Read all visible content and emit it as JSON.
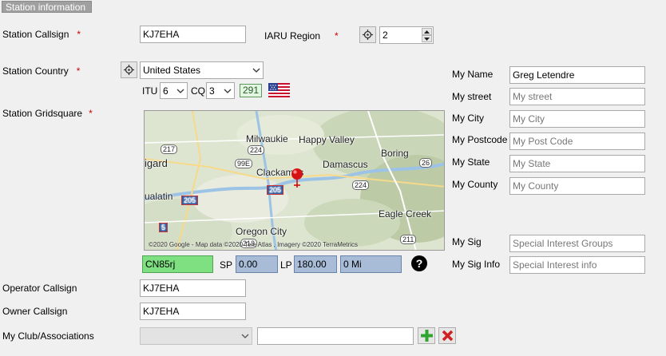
{
  "section": {
    "title": "Station information"
  },
  "station_callsign": {
    "label": "Station Callsign",
    "required_mark": "*",
    "value": "KJ7EHA"
  },
  "iaru_region": {
    "label": "IARU Region",
    "required_mark": "*",
    "value": "2"
  },
  "station_country": {
    "label": "Station Country",
    "required_mark": "*",
    "value": "United States"
  },
  "itu": {
    "label": "ITU",
    "value": "6"
  },
  "cq": {
    "label": "CQ",
    "value": "3"
  },
  "dxcc": {
    "value": "291"
  },
  "station_gridsquare": {
    "label": "Station Gridsquare",
    "required_mark": "*"
  },
  "map": {
    "towns": [
      "Milwaukie",
      "Happy Valley",
      "Boring",
      "Clackamas",
      "Damascus",
      "igard",
      "ualatin",
      "Oregon City",
      "Eagle Creek"
    ],
    "shields": [
      "217",
      "224",
      "99E",
      "26",
      "224",
      "205",
      "5",
      "205",
      "213",
      "211"
    ],
    "attribution": "©2020 Google - Map data ©2020 Tele Atlas , Imagery ©2020 TerraMetrics"
  },
  "gridsquare": {
    "value": "CN85rj"
  },
  "sp": {
    "label": "SP",
    "value": "0.00"
  },
  "lp": {
    "label": "LP",
    "value": "180.00"
  },
  "distance": {
    "value": "0 Mi"
  },
  "help": {
    "glyph": "?"
  },
  "my_fields": {
    "name": {
      "label": "My Name",
      "value": "Greg Letendre",
      "placeholder": ""
    },
    "street": {
      "label": "My street",
      "value": "",
      "placeholder": "My street"
    },
    "city": {
      "label": "My City",
      "value": "",
      "placeholder": "My City"
    },
    "postcode": {
      "label": "My Postcode",
      "value": "",
      "placeholder": "My Post Code"
    },
    "state": {
      "label": "My State",
      "value": "",
      "placeholder": "My State"
    },
    "county": {
      "label": "My County",
      "value": "",
      "placeholder": "My County"
    },
    "sig": {
      "label": "My Sig",
      "value": "",
      "placeholder": "Special Interest Groups"
    },
    "sig_info": {
      "label": "My Sig Info",
      "value": "",
      "placeholder": "Special Interest info"
    }
  },
  "operator_callsign": {
    "label": "Operator Callsign",
    "value": "KJ7EHA"
  },
  "owner_callsign": {
    "label": "Owner Callsign",
    "value": "KJ7EHA"
  },
  "club": {
    "label": "My Club/Associations",
    "selected": "",
    "text": ""
  },
  "colors": {
    "required": "#d00000",
    "grid_ok": "#7ee081",
    "readonly_blue": "#a8bcd8",
    "add": "#2fa52f",
    "remove": "#d02020"
  },
  "icons": [
    "crosshair-icon",
    "chevron-down-icon",
    "us-flag-icon",
    "map-pin-icon",
    "help-icon",
    "plus-icon",
    "x-icon"
  ]
}
